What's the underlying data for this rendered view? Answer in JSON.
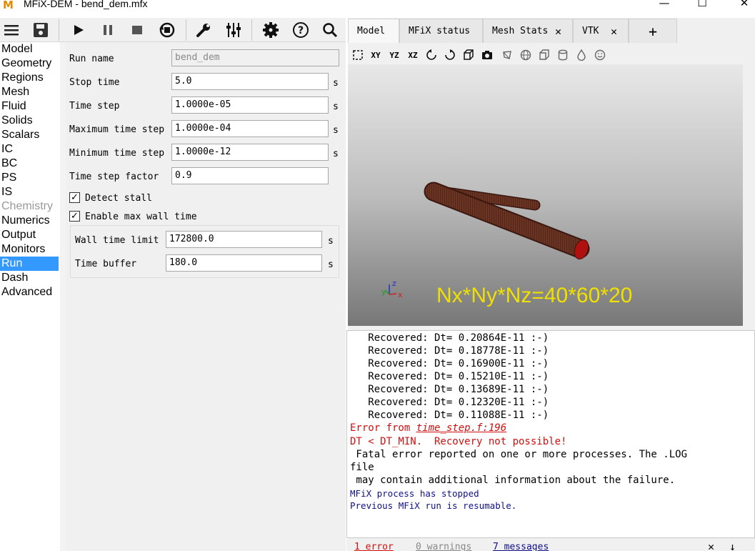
{
  "window": {
    "title": "MFiX-DEM - bend_dem.mfx",
    "logo_letter": "M",
    "minimize": "—",
    "maximize": "☐",
    "close": "✕"
  },
  "nav": {
    "items": [
      {
        "label": "Model"
      },
      {
        "label": "Geometry"
      },
      {
        "label": "Regions"
      },
      {
        "label": "Mesh"
      },
      {
        "label": "Fluid"
      },
      {
        "label": "Solids"
      },
      {
        "label": "Scalars"
      },
      {
        "label": "IC"
      },
      {
        "label": "BC"
      },
      {
        "label": "PS"
      },
      {
        "label": "IS"
      },
      {
        "label": "Chemistry"
      },
      {
        "label": "Numerics"
      },
      {
        "label": "Output"
      },
      {
        "label": "Monitors"
      },
      {
        "label": "Run"
      },
      {
        "label": "Dash"
      },
      {
        "label": "Advanced"
      }
    ],
    "active": "Run",
    "disabled": "Chemistry"
  },
  "run_form": {
    "run_name": {
      "label": "Run name",
      "value": "bend_dem"
    },
    "stop_time": {
      "label": "Stop time",
      "value": "5.0",
      "unit": "s"
    },
    "time_step": {
      "label": "Time step",
      "value": "1.0000e-05",
      "unit": "s"
    },
    "max_time_step": {
      "label": "Maximum time step",
      "value": "1.0000e-04",
      "unit": "s"
    },
    "min_time_step": {
      "label": "Minimum time step",
      "value": "1.0000e-12",
      "unit": "s"
    },
    "time_step_factor": {
      "label": "Time step factor",
      "value": "0.9"
    },
    "detect_stall": {
      "label": "Detect stall",
      "checked": true,
      "mark": "✓"
    },
    "enable_max_wall_time": {
      "label": "Enable max wall time",
      "checked": true,
      "mark": "✓"
    },
    "wall_time_limit": {
      "label": "Wall time limit",
      "value": "172800.0",
      "unit": "s"
    },
    "time_buffer": {
      "label": "Time buffer",
      "value": "180.0",
      "unit": "s"
    }
  },
  "tabs": [
    {
      "label": "Model",
      "active": true
    },
    {
      "label": "MFiX status"
    },
    {
      "label": "Mesh Stats",
      "closable": true
    },
    {
      "label": "VTK",
      "closable": true
    },
    {
      "label": "+"
    }
  ],
  "tab_close_glyph": "✕",
  "viewport": {
    "overlay_text": "Nx*Ny*Nz=40*60*20",
    "axes": {
      "x": "x",
      "y": "y",
      "z": "z"
    },
    "colors": {
      "tube": "#5a2a1a",
      "tube_end": "#b01010",
      "overlay": "#f0e000"
    }
  },
  "vtk_toolbar_labels": {
    "xy": "XY",
    "yz": "YZ",
    "xz": "XZ"
  },
  "console": {
    "recovered": [
      "   Recovered: Dt= 0.20864E-11 :-)",
      "   Recovered: Dt= 0.18778E-11 :-)",
      "   Recovered: Dt= 0.16900E-11 :-)",
      "   Recovered: Dt= 0.15210E-11 :-)",
      "   Recovered: Dt= 0.13689E-11 :-)",
      "   Recovered: Dt= 0.12320E-11 :-)",
      "   Recovered: Dt= 0.11088E-11 :-)"
    ],
    "error_prefix": "Error from ",
    "error_link": "time_step.f:196",
    "dt_error": "DT < DT_MIN.  Recovery not possible!",
    "fatal_1": " Fatal error reported on one or more processes. The .LOG",
    "fatal_2": "file",
    "fatal_3": " may contain additional information about the failure.",
    "stopped": "MFiX process has stopped",
    "resumable": "Previous MFiX run is resumable.",
    "colors": {
      "error": "#d01010",
      "info": "#10108a"
    }
  },
  "status": {
    "errors": "1 error",
    "warnings": "0 warnings",
    "messages": "7 messages"
  }
}
